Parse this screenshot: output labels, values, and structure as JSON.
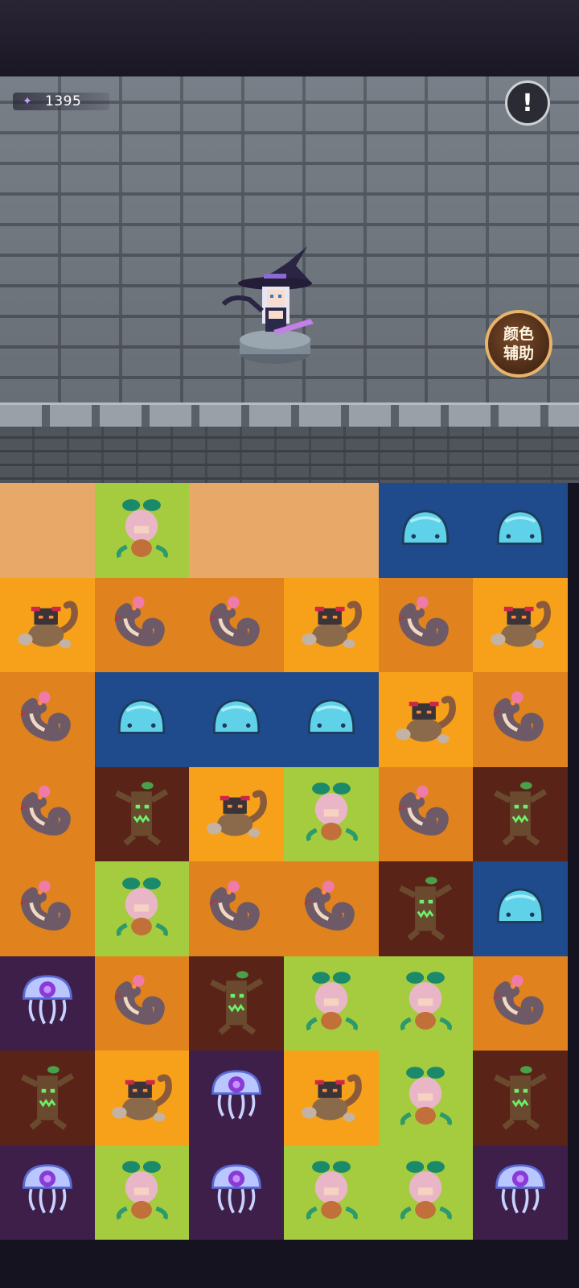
{
  "hud": {
    "currency_icon": "butterfly-gem-icon",
    "currency_value": "1395",
    "alert_icon": "exclamation-icon",
    "alert_symbol": "!",
    "color_assist_label": "颜色辅助"
  },
  "colors": {
    "board_orange": "#e0821d",
    "board_amber": "#f7a11a",
    "board_blue": "#1f4b8d",
    "board_green": "#a5cc3f",
    "board_brown": "#5a2317",
    "board_purple": "#3e1f4a",
    "board_sand": "#e8a868"
  },
  "board": {
    "rows": [
      [
        "empty",
        "mandrake",
        "empty",
        "empty",
        "slime",
        "slime"
      ],
      [
        "scorpion",
        "snake",
        "snake",
        "scorpion",
        "snake",
        "scorpion"
      ],
      [
        "snake",
        "slime",
        "slime",
        "slime",
        "scorpion",
        "snake"
      ],
      [
        "snake",
        "treant",
        "scorpion",
        "mandrake",
        "snake",
        "treant"
      ],
      [
        "snake",
        "mandrake",
        "snake",
        "snake",
        "treant",
        "slime"
      ],
      [
        "jellyfish",
        "snake",
        "treant",
        "mandrake",
        "mandrake",
        "snake"
      ],
      [
        "treant",
        "scorpion",
        "jellyfish",
        "scorpion",
        "mandrake",
        "treant"
      ],
      [
        "jellyfish",
        "mandrake",
        "jellyfish",
        "mandrake",
        "mandrake",
        "jellyfish"
      ]
    ]
  }
}
